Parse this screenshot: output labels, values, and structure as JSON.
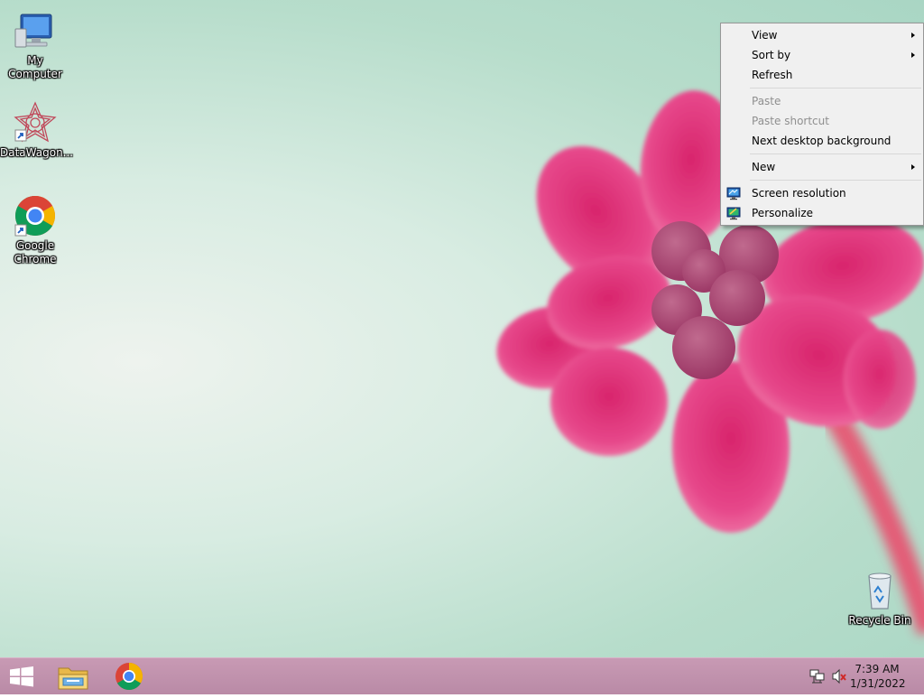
{
  "desktop_icons": [
    {
      "label": "My Computer",
      "icon": "computer-icon"
    },
    {
      "label": "DataWagon...",
      "icon": "datawagon-icon"
    },
    {
      "label": "Google Chrome",
      "icon": "chrome-icon"
    },
    {
      "label": "Recycle Bin",
      "icon": "recycle-bin-icon"
    }
  ],
  "context_menu": {
    "items": [
      {
        "label": "View",
        "submenu": true,
        "enabled": true
      },
      {
        "label": "Sort by",
        "submenu": true,
        "enabled": true
      },
      {
        "label": "Refresh",
        "submenu": false,
        "enabled": true
      },
      {
        "label": "Paste",
        "submenu": false,
        "enabled": false
      },
      {
        "label": "Paste shortcut",
        "submenu": false,
        "enabled": false
      },
      {
        "label": "Next desktop background",
        "submenu": false,
        "enabled": true
      },
      {
        "label": "New",
        "submenu": true,
        "enabled": true
      },
      {
        "label": "Screen resolution",
        "submenu": false,
        "enabled": true,
        "icon": "display-settings-icon"
      },
      {
        "label": "Personalize",
        "submenu": false,
        "enabled": true,
        "icon": "personalize-icon"
      }
    ]
  },
  "taskbar": {
    "start_icon": "windows-start-icon",
    "pinned": [
      "file-explorer-icon",
      "chrome-icon"
    ],
    "tray": [
      "network-icon",
      "volume-muted-icon"
    ],
    "clock": {
      "time": "7:39 AM",
      "date": "1/31/2022"
    }
  },
  "colors": {
    "taskbar": "#c89ab4",
    "menu_background": "#f0f0f0",
    "wallpaper_bg": "#b7ddcb",
    "flower": "#e0407e"
  }
}
